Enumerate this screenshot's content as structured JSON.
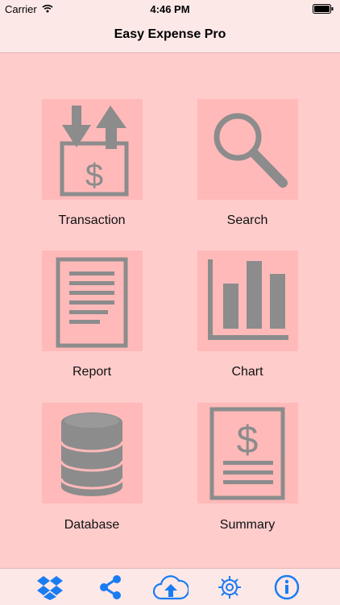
{
  "status_bar": {
    "carrier": "Carrier",
    "time": "4:46 PM"
  },
  "nav": {
    "title": "Easy Expense Pro"
  },
  "menu": {
    "items": [
      {
        "label": "Transaction",
        "icon": "transaction-icon"
      },
      {
        "label": "Search",
        "icon": "search-icon"
      },
      {
        "label": "Report",
        "icon": "report-icon"
      },
      {
        "label": "Chart",
        "icon": "chart-icon"
      },
      {
        "label": "Database",
        "icon": "database-icon"
      },
      {
        "label": "Summary",
        "icon": "summary-icon"
      }
    ]
  },
  "tab_bar": {
    "tabs": [
      {
        "icon": "dropbox-icon"
      },
      {
        "icon": "share-icon"
      },
      {
        "icon": "cloud-upload-icon"
      },
      {
        "icon": "gear-icon"
      },
      {
        "icon": "info-icon"
      }
    ]
  },
  "colors": {
    "background": "#ffcccc",
    "tile": "#ffb9b9",
    "icon_gray": "#8c8c8c",
    "accent_blue": "#1a7cf2",
    "bar": "#fde8e8"
  }
}
